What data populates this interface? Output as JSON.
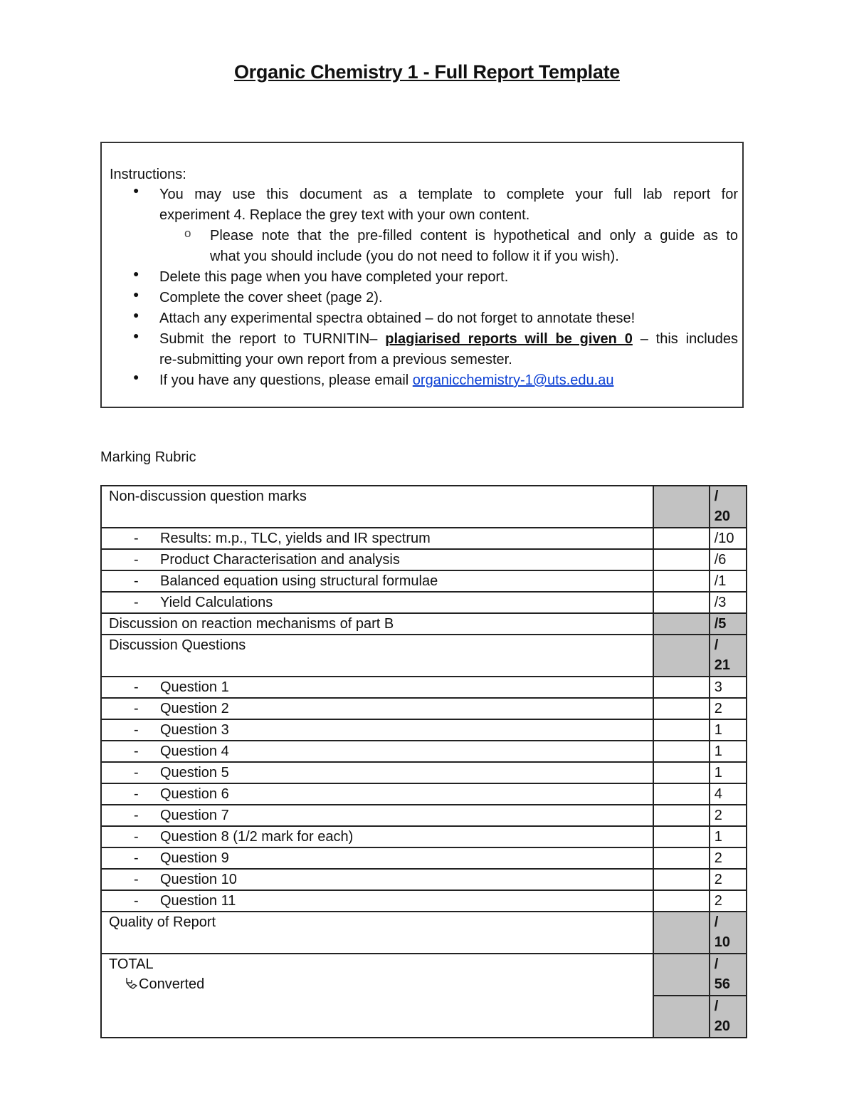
{
  "document": {
    "title": "Organic Chemistry 1 - Full Report Template"
  },
  "instructions": {
    "heading": "Instructions:",
    "items": [
      {
        "level": 1,
        "line1": "You may use this document as a template to complete your full lab report for",
        "line2": "experiment 4. Replace the grey text with your own content."
      },
      {
        "level": 2,
        "line1": "Please note that the pre-filled content is hypothetical and only a guide as to",
        "line2": "what you should include (you do not need to follow it if you wish)."
      },
      {
        "level": 1,
        "line1": "Delete this page when you have completed your report."
      },
      {
        "level": 1,
        "line1": "Complete the cover sheet (page 2)."
      },
      {
        "level": 1,
        "line1": "Attach any experimental spectra obtained – do not forget to annotate these!"
      },
      {
        "level": 1,
        "prefix": "Submit the report to TURNITIN– ",
        "emphasis": "plagiarised reports will be given 0",
        "suffix": " – this includes",
        "line2": "re-submitting your own report from a previous semester."
      },
      {
        "level": 1,
        "prefix": "If you have any questions, please email ",
        "email": "organicchemistry-1@uts.edu.au"
      }
    ],
    "bullet_glyph": "●",
    "sub_bullet_glyph": "o"
  },
  "rubric": {
    "heading": "Marking Rubric",
    "dash": "-",
    "rows": [
      {
        "type": "section",
        "label": "Non-discussion question marks",
        "slash": "/",
        "max": "20"
      },
      {
        "type": "item",
        "label": "Results: m.p., TLC, yields and IR spectrum",
        "max": "/10"
      },
      {
        "type": "item",
        "label": "Product Characterisation and analysis",
        "max": "/6"
      },
      {
        "type": "item",
        "label": "Balanced equation using structural formulae",
        "max": "/1"
      },
      {
        "type": "item",
        "label": "Yield Calculations",
        "max": "/3"
      },
      {
        "type": "section-single",
        "label": "Discussion on reaction mechanisms of part B",
        "max": "/5"
      },
      {
        "type": "section",
        "label": "Discussion Questions",
        "slash": "/",
        "max": "21"
      },
      {
        "type": "item",
        "label": "Question 1",
        "max": "3"
      },
      {
        "type": "item",
        "label": "Question 2",
        "max": "2"
      },
      {
        "type": "item",
        "label": "Question 3",
        "max": "1"
      },
      {
        "type": "item",
        "label": "Question 4",
        "max": "1"
      },
      {
        "type": "item",
        "label": "Question 5",
        "max": "1"
      },
      {
        "type": "item",
        "label": "Question 6",
        "max": "4"
      },
      {
        "type": "item",
        "label": "Question 7",
        "max": "2"
      },
      {
        "type": "item",
        "label": "Question 8 (1/2 mark for each)",
        "max": "1"
      },
      {
        "type": "item",
        "label": "Question 9",
        "max": "2"
      },
      {
        "type": "item",
        "label": "Question 10",
        "max": "2"
      },
      {
        "type": "item",
        "label": "Question 11",
        "max": "2"
      },
      {
        "type": "section",
        "label": "Quality of Report",
        "slash": "/",
        "max": "10"
      }
    ],
    "total": {
      "label": "TOTAL",
      "converted_label": "Converted",
      "converted_icon": "converted-arrow-icon",
      "raw_slash": "/",
      "raw_max": "56",
      "converted_slash": "/",
      "converted_max": "20"
    }
  }
}
